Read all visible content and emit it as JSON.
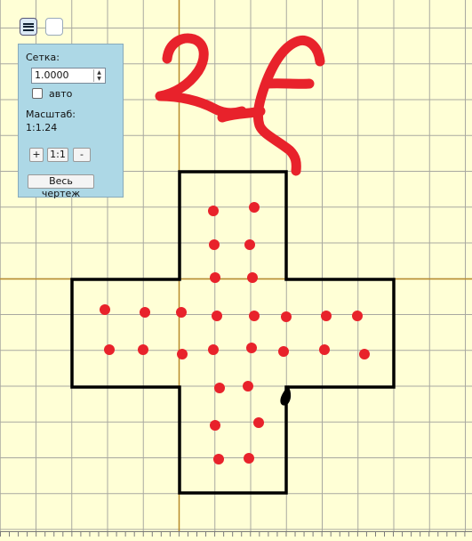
{
  "toolbar": {
    "menu_icon": "hamburger-menu-icon",
    "blank_button_label": ""
  },
  "panel": {
    "grid_label": "Сетка:",
    "grid_value": "1.0000",
    "auto_label": "авто",
    "auto_checked": false,
    "scale_label": "Масштаб:",
    "scale_value": "1:1.24",
    "zoom_in_label": "+",
    "zoom_reset_label": "1:1",
    "zoom_out_label": "-",
    "fit_label": "Весь чертеж"
  },
  "colors": {
    "background": "#ffffd6",
    "grid": "#a8a8a0",
    "axis": "#b88a2a",
    "shape": "#000000",
    "dots": "#e8222b",
    "annotation": "#e8222b",
    "panel": "#add8e6"
  }
}
